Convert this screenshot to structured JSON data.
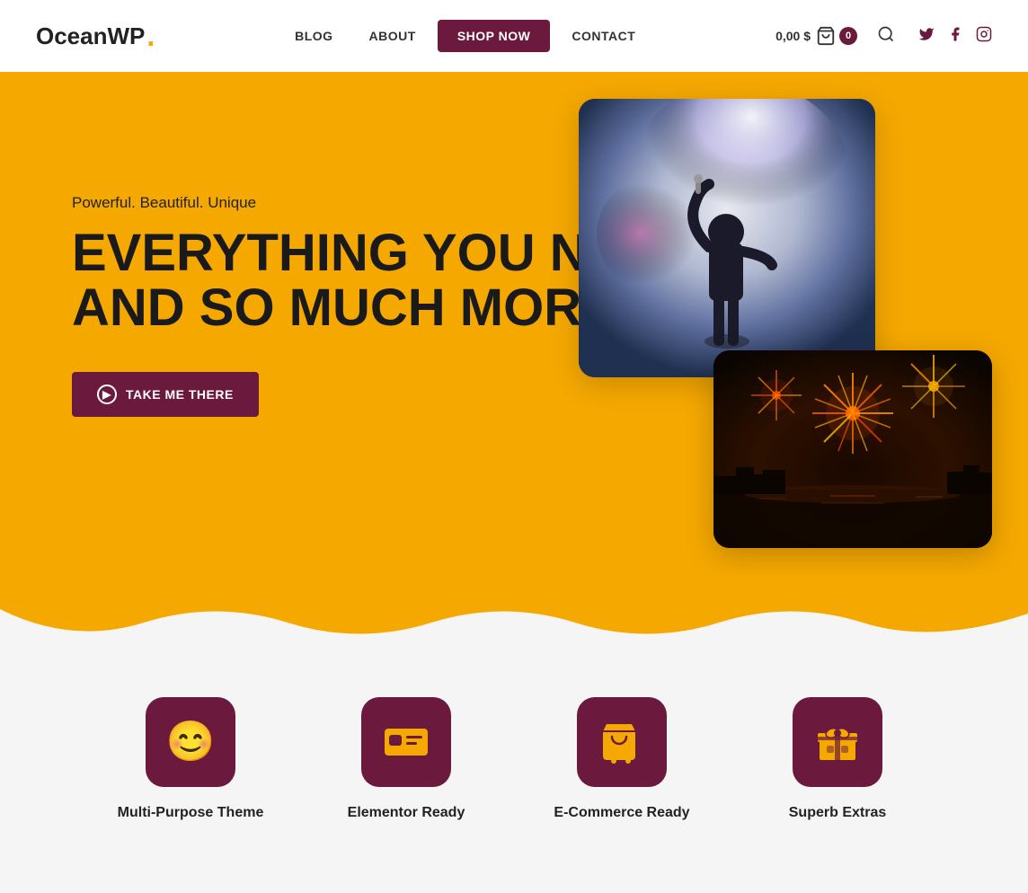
{
  "site": {
    "logo_text": "OceanWP",
    "logo_dot": "."
  },
  "header": {
    "nav": [
      {
        "label": "BLOG",
        "id": "blog",
        "active": false,
        "is_btn": false
      },
      {
        "label": "ABOUT",
        "id": "about",
        "active": false,
        "is_btn": false
      },
      {
        "label": "SHOP NOW",
        "id": "shop-now",
        "active": false,
        "is_btn": true
      },
      {
        "label": "CONTACT",
        "id": "contact",
        "active": false,
        "is_btn": false
      }
    ],
    "cart": {
      "price": "0,00 $",
      "count": "0"
    },
    "social": [
      {
        "id": "twitter",
        "icon": "𝕏",
        "label": "Twitter"
      },
      {
        "id": "facebook",
        "icon": "f",
        "label": "Facebook"
      },
      {
        "id": "instagram",
        "icon": "◎",
        "label": "Instagram"
      }
    ]
  },
  "hero": {
    "tagline": "Powerful. Beautiful. Unique",
    "title_line1": "EVERYTHING YOU NEED",
    "title_line2": "AND SO MUCH MORE",
    "cta_label": "TAKE ME THERE",
    "bg_color": "#f5a800"
  },
  "features": [
    {
      "id": "multi-purpose",
      "label": "Multi-Purpose Theme",
      "icon": "😊"
    },
    {
      "id": "elementor",
      "label": "Elementor Ready",
      "icon": "🪪"
    },
    {
      "id": "ecommerce",
      "label": "E-Commerce Ready",
      "icon": "🛒"
    },
    {
      "id": "extras",
      "label": "Superb Extras",
      "icon": "🎁"
    }
  ],
  "colors": {
    "brand_purple": "#6b1a3d",
    "brand_yellow": "#f5a800",
    "text_dark": "#1a1a1a",
    "bg_light": "#f5f5f5"
  }
}
